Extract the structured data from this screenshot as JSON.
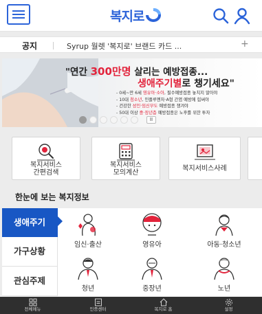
{
  "header": {
    "logo_text": "복지로",
    "menu_icon": "hamburger-menu-icon",
    "search_icon": "search-icon",
    "user_icon": "user-icon",
    "accent_color": "#2b63d9"
  },
  "notice": {
    "label": "공지",
    "text": "Syrup 월렛 '복지로' 브랜드 카드 ...",
    "more": "+"
  },
  "banner": {
    "title_prefix": "\"연간 ",
    "title_highlight": "300만명",
    "title_suffix": " 살리는 예방접종...",
    "subtitle_highlight": "생애주기별",
    "subtitle_suffix": "로 챙기세요\"",
    "bullets": [
      {
        "pre": "- 0세~만 6세 ",
        "red": "영유아·소아",
        "post": ", 필수예방접종 놓치지 말아야"
      },
      {
        "pre": "- 10대 ",
        "red": "청소년",
        "post": ", 인플루엔자·A형 간염 예방에 힘써야"
      },
      {
        "pre": "- 건강한 ",
        "red": "성인·임신부도",
        "post": " 예방접종 챙겨야"
      },
      {
        "pre": "- 50대 이상 ",
        "red": "중·장년층",
        "post": " 예방접종은 노후를 위한 투자"
      }
    ],
    "slide_count": 6,
    "active_slide": 1,
    "pause_label": "II",
    "accent_color": "#e2233b"
  },
  "services": [
    {
      "line1": "복지서비스",
      "line2": "간편검색",
      "icon": "search-document-icon"
    },
    {
      "line1": "복지서비스",
      "line2": "모의계산",
      "icon": "calculator-icon"
    },
    {
      "line1": "복지서비스사례",
      "line2": "",
      "icon": "case-photo-icon"
    }
  ],
  "welfare": {
    "title": "한눈에 보는 복지정보",
    "tabs": [
      {
        "line1": "생애",
        "line2": "주기",
        "active": true
      },
      {
        "line1": "가구",
        "line2": "상황",
        "active": false
      },
      {
        "line1": "관심",
        "line2": "주제",
        "active": false
      }
    ],
    "categories": [
      {
        "label": "임신·출산",
        "icon": "pregnant-woman-icon"
      },
      {
        "label": "영유아",
        "icon": "baby-icon"
      },
      {
        "label": "아동·청소년",
        "icon": "child-icon"
      },
      {
        "label": "청년",
        "icon": "young-adult-icon"
      },
      {
        "label": "중장년",
        "icon": "middle-aged-icon"
      },
      {
        "label": "노년",
        "icon": "elderly-icon"
      }
    ],
    "active_color": "#1857c4"
  },
  "bottom_nav": [
    {
      "label": "전체메뉴",
      "icon": "grid-menu-icon"
    },
    {
      "label": "인증센터",
      "icon": "certificate-icon"
    },
    {
      "label": "복지로 홈",
      "icon": "home-icon"
    },
    {
      "label": "설정",
      "icon": "settings-gear-icon"
    }
  ]
}
